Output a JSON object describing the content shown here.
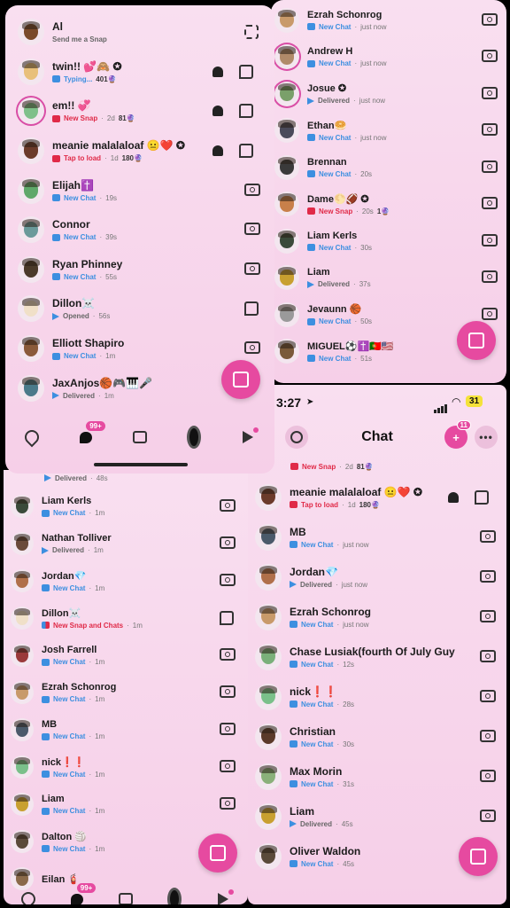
{
  "panel1": {
    "rows": [
      {
        "name": "Al",
        "status_type": "none",
        "status": "Send me a Snap",
        "time": "",
        "extra": "",
        "right": "scan",
        "avatar_color": "#7a4a2a",
        "ring": false
      },
      {
        "name": "twin!! 💕🙈 ✪",
        "status_type": "typing",
        "status": "Typing...",
        "time": "",
        "extra": "401🔮",
        "right": "ghost-bubble",
        "avatar_color": "#e8c07a",
        "ring": false
      },
      {
        "name": "em!! 💞",
        "status_type": "snap",
        "status": "New Snap",
        "time": "2d",
        "extra": "81🔮",
        "right": "ghost-bubble",
        "avatar_color": "#7ec08a",
        "ring": true
      },
      {
        "name": "meanie malalaloaf 😐❤️ ✪",
        "status_type": "snap",
        "status": "Tap to load",
        "time": "1d",
        "extra": "180🔮",
        "right": "ghost-bubble",
        "avatar_color": "#6b3b2a",
        "ring": false
      },
      {
        "name": "Elijah✝️",
        "status_type": "chat",
        "status": "New Chat",
        "time": "19s",
        "extra": "",
        "right": "camera",
        "avatar_color": "#5fa86a",
        "ring": false
      },
      {
        "name": "Connor",
        "status_type": "chat",
        "status": "New Chat",
        "time": "39s",
        "extra": "",
        "right": "camera",
        "avatar_color": "#6a9a9a",
        "ring": false
      },
      {
        "name": "Ryan Phinney",
        "status_type": "chat",
        "status": "New Chat",
        "time": "55s",
        "extra": "",
        "right": "camera",
        "avatar_color": "#4a3a2a",
        "ring": false
      },
      {
        "name": "Dillon☠️",
        "status_type": "open",
        "status": "Opened",
        "time": "56s",
        "extra": "",
        "right": "bubble",
        "avatar_color": "#f0e0c8",
        "ring": false
      },
      {
        "name": "Elliott Shapiro",
        "status_type": "chat",
        "status": "New Chat",
        "time": "1m",
        "extra": "",
        "right": "camera",
        "avatar_color": "#8a5a3a",
        "ring": false
      },
      {
        "name": "JaxAnjos🏀🎮🎹🎤",
        "status_type": "delivered",
        "status": "Delivered",
        "time": "1m",
        "extra": "",
        "right": "",
        "avatar_color": "#4a7a8a",
        "ring": false
      }
    ],
    "nav_badge": "99+"
  },
  "panel2": {
    "rows": [
      {
        "name": "Ezrah Schonrog",
        "status_type": "chat",
        "status": "New Chat",
        "time": "just now",
        "extra": "",
        "right": "camera",
        "avatar_color": "#c89a6a",
        "ring": false
      },
      {
        "name": "Andrew H",
        "status_type": "chat",
        "status": "New Chat",
        "time": "just now",
        "extra": "",
        "right": "camera",
        "avatar_color": "#b08a6a",
        "ring": true
      },
      {
        "name": "Josue ✪",
        "status_type": "delivered",
        "status": "Delivered",
        "time": "just now",
        "extra": "",
        "right": "camera",
        "avatar_color": "#7aa06a",
        "ring": true
      },
      {
        "name": "Ethan🥯",
        "status_type": "chat",
        "status": "New Chat",
        "time": "just now",
        "extra": "",
        "right": "camera",
        "avatar_color": "#4a4a5a",
        "ring": false
      },
      {
        "name": "Brennan",
        "status_type": "chat",
        "status": "New Chat",
        "time": "20s",
        "extra": "",
        "right": "camera",
        "avatar_color": "#3a3a3a",
        "ring": false
      },
      {
        "name": "Dame🌕🏈 ✪",
        "status_type": "snap",
        "status": "New Snap",
        "time": "20s",
        "extra": "1🔮",
        "right": "camera",
        "avatar_color": "#c8804a",
        "ring": false
      },
      {
        "name": "Liam Kerls",
        "status_type": "chat",
        "status": "New Chat",
        "time": "30s",
        "extra": "",
        "right": "camera",
        "avatar_color": "#3a4a3a",
        "ring": false
      },
      {
        "name": "Liam",
        "status_type": "delivered",
        "status": "Delivered",
        "time": "37s",
        "extra": "",
        "right": "camera",
        "avatar_color": "#c8a030",
        "ring": false
      },
      {
        "name": "Jevaunn 🏀",
        "status_type": "chat",
        "status": "New Chat",
        "time": "50s",
        "extra": "",
        "right": "camera",
        "avatar_color": "#9a9a9a",
        "ring": false
      },
      {
        "name": "MIGUEL⚽️✝️🇵🇹🇺🇸",
        "status_type": "chat",
        "status": "New Chat",
        "time": "51s",
        "extra": "",
        "right": "",
        "avatar_color": "#7a5a3a",
        "ring": false
      }
    ]
  },
  "panel3": {
    "top_partial": {
      "status": "Delivered",
      "time": "48s"
    },
    "rows": [
      {
        "name": "Liam Kerls",
        "status_type": "chat",
        "status": "New Chat",
        "time": "1m",
        "extra": "",
        "right": "camera",
        "avatar_color": "#3a4a3a",
        "ring": false
      },
      {
        "name": "Nathan Tolliver",
        "status_type": "delivered",
        "status": "Delivered",
        "time": "1m",
        "extra": "",
        "right": "camera",
        "avatar_color": "#6a4a3a",
        "ring": false
      },
      {
        "name": "Jordan💎",
        "status_type": "chat",
        "status": "New Chat",
        "time": "1m",
        "extra": "",
        "right": "camera",
        "avatar_color": "#b0704a",
        "ring": false
      },
      {
        "name": "Dillon☠️",
        "status_type": "mixed",
        "status": "New Snap and Chats",
        "time": "1m",
        "extra": "",
        "right": "bubble",
        "avatar_color": "#f0e0c8",
        "ring": false
      },
      {
        "name": "Josh Farrell",
        "status_type": "chat",
        "status": "New Chat",
        "time": "1m",
        "extra": "",
        "right": "camera",
        "avatar_color": "#9a3a3a",
        "ring": false
      },
      {
        "name": "Ezrah Schonrog",
        "status_type": "chat",
        "status": "New Chat",
        "time": "1m",
        "extra": "",
        "right": "camera",
        "avatar_color": "#c89a6a",
        "ring": false
      },
      {
        "name": "MB",
        "status_type": "chat",
        "status": "New Chat",
        "time": "1m",
        "extra": "",
        "right": "camera",
        "avatar_color": "#4a5a6a",
        "ring": false
      },
      {
        "name": "nick❗❗",
        "status_type": "chat",
        "status": "New Chat",
        "time": "1m",
        "extra": "",
        "right": "camera",
        "avatar_color": "#7ac08a",
        "ring": false
      },
      {
        "name": "Liam",
        "status_type": "chat",
        "status": "New Chat",
        "time": "1m",
        "extra": "",
        "right": "camera",
        "avatar_color": "#c8a030",
        "ring": false
      },
      {
        "name": "Dalton 🏐",
        "status_type": "chat",
        "status": "New Chat",
        "time": "1m",
        "extra": "",
        "right": "",
        "avatar_color": "#5a4a3a",
        "ring": false
      },
      {
        "name": "Eilan 🧯",
        "status_type": "none",
        "status": "",
        "time": "",
        "extra": "",
        "right": "",
        "avatar_color": "#8a6a4a",
        "ring": false
      }
    ],
    "nav_badge": "99+"
  },
  "panel4": {
    "clock": "3:27",
    "battery": "31",
    "title": "Chat",
    "add_badge": "11",
    "top_partial": {
      "status": "New Snap",
      "time": "2d",
      "extra": "81🔮"
    },
    "rows": [
      {
        "name": "meanie malalaloaf 😐❤️ ✪",
        "status_type": "snap",
        "status": "Tap to load",
        "time": "1d",
        "extra": "180🔮",
        "right": "ghost-bubble",
        "avatar_color": "#6b3b2a",
        "ring": false
      },
      {
        "name": "MB",
        "status_type": "chat",
        "status": "New Chat",
        "time": "just now",
        "extra": "",
        "right": "camera",
        "avatar_color": "#4a5a6a",
        "ring": false
      },
      {
        "name": "Jordan💎",
        "status_type": "delivered",
        "status": "Delivered",
        "time": "just now",
        "extra": "",
        "right": "camera",
        "avatar_color": "#b0704a",
        "ring": false
      },
      {
        "name": "Ezrah Schonrog",
        "status_type": "chat",
        "status": "New Chat",
        "time": "just now",
        "extra": "",
        "right": "camera",
        "avatar_color": "#c89a6a",
        "ring": false
      },
      {
        "name": "Chase Lusiak(fourth Of July Guy",
        "status_type": "chat",
        "status": "New Chat",
        "time": "12s",
        "extra": "",
        "right": "camera",
        "avatar_color": "#7ab07a",
        "ring": false
      },
      {
        "name": "nick❗❗",
        "status_type": "chat",
        "status": "New Chat",
        "time": "28s",
        "extra": "",
        "right": "camera",
        "avatar_color": "#7ac08a",
        "ring": false
      },
      {
        "name": "Christian",
        "status_type": "chat",
        "status": "New Chat",
        "time": "30s",
        "extra": "",
        "right": "camera",
        "avatar_color": "#5a3a2a",
        "ring": false
      },
      {
        "name": "Max Morin",
        "status_type": "chat",
        "status": "New Chat",
        "time": "31s",
        "extra": "",
        "right": "camera",
        "avatar_color": "#8ab07a",
        "ring": false
      },
      {
        "name": "Liam",
        "status_type": "delivered",
        "status": "Delivered",
        "time": "45s",
        "extra": "",
        "right": "camera",
        "avatar_color": "#c8a030",
        "ring": false
      },
      {
        "name": "Oliver Waldon",
        "status_type": "chat",
        "status": "New Chat",
        "time": "45s",
        "extra": "",
        "right": "",
        "avatar_color": "#5a4a3a",
        "ring": false
      }
    ]
  }
}
